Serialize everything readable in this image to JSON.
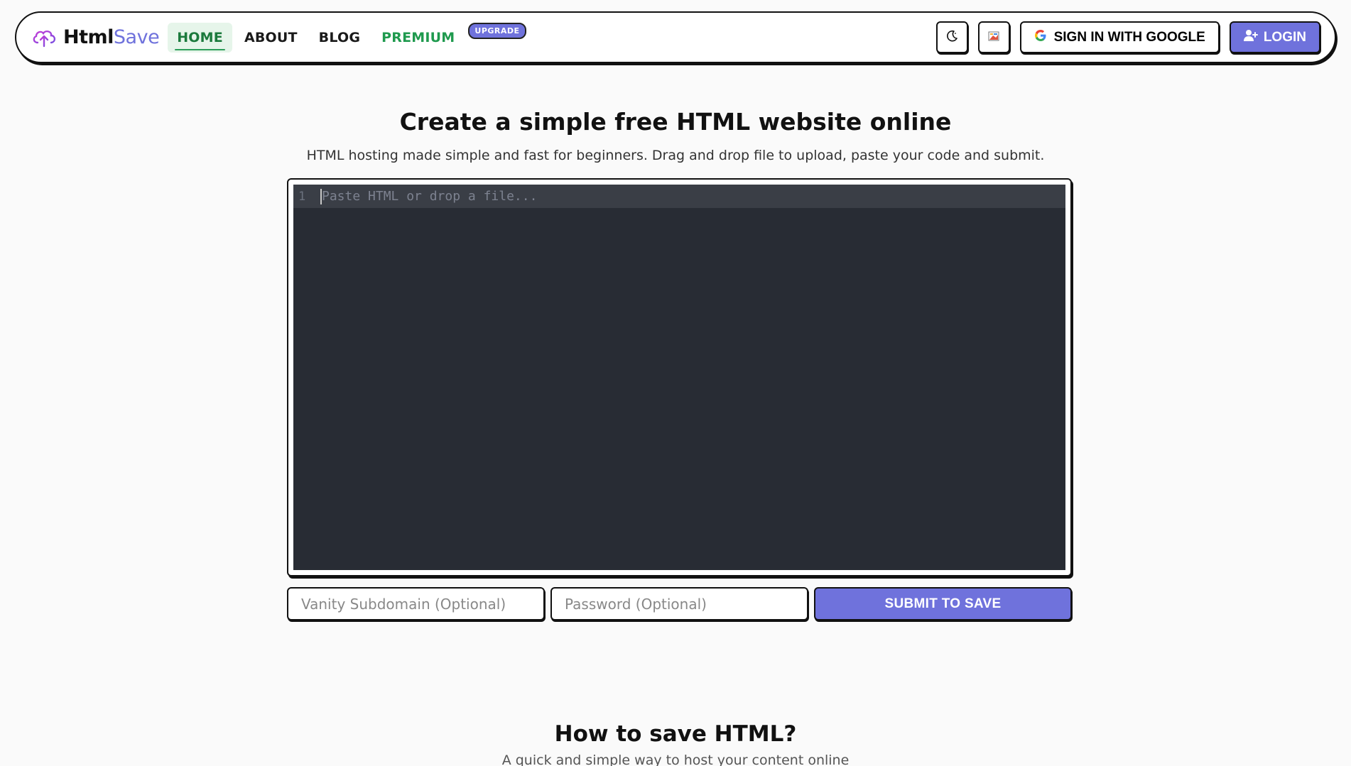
{
  "brand": {
    "part1": "Html",
    "part2": "Save",
    "accent_color": "#6f72dc"
  },
  "nav": {
    "items": [
      {
        "label": "HOME",
        "active": true
      },
      {
        "label": "ABOUT"
      },
      {
        "label": "BLOG"
      },
      {
        "label": "PREMIUM"
      }
    ],
    "upgrade_badge": "UPGRADE"
  },
  "toolbar": {
    "theme_icon": "moon-icon",
    "palette_icon": "palette-icon",
    "google_label": "SIGN IN WITH GOOGLE",
    "login_label": "LOGIN"
  },
  "hero": {
    "title": "Create a simple free HTML website online",
    "subtitle": "HTML hosting made simple and fast for beginners. Drag and drop file to upload, paste your code and submit."
  },
  "editor": {
    "line_number": "1",
    "placeholder": "Paste HTML or drop a file..."
  },
  "form": {
    "subdomain_placeholder": "Vanity Subdomain (Optional)",
    "password_placeholder": "Password (Optional)",
    "submit_label": "SUBMIT TO SAVE"
  },
  "section": {
    "title": "How to save HTML?",
    "subtitle": "A quick and simple way to host your content online"
  }
}
